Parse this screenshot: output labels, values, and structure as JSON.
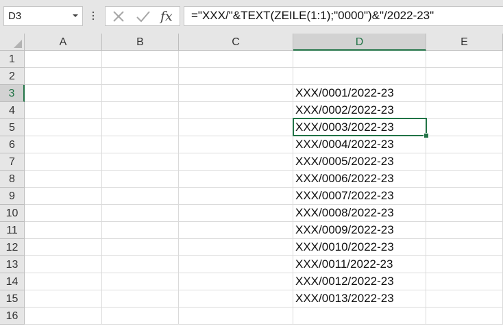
{
  "formula_bar": {
    "name_box": "D3",
    "formula": "=\"XXX/\"&TEXT(ZEILE(1:1);\"0000\")&\"/2022-23\"",
    "cancel_icon": "x-icon",
    "enter_icon": "check-icon",
    "function_icon": "fx-icon"
  },
  "columns": [
    "A",
    "B",
    "C",
    "D",
    "E"
  ],
  "rows": [
    "1",
    "2",
    "3",
    "4",
    "5",
    "6",
    "7",
    "8",
    "9",
    "10",
    "11",
    "12",
    "13",
    "14",
    "15",
    "16"
  ],
  "active_cell": "D3",
  "column_d_values": [
    "",
    "",
    "XXX/0001/2022-23",
    "XXX/0002/2022-23",
    "XXX/0003/2022-23",
    "XXX/0004/2022-23",
    "XXX/0005/2022-23",
    "XXX/0006/2022-23",
    "XXX/0007/2022-23",
    "XXX/0008/2022-23",
    "XXX/0009/2022-23",
    "XXX/0010/2022-23",
    "XXX/0011/2022-23",
    "XXX/0012/2022-23",
    "XXX/0013/2022-23",
    ""
  ],
  "colors": {
    "accent": "#217346"
  }
}
